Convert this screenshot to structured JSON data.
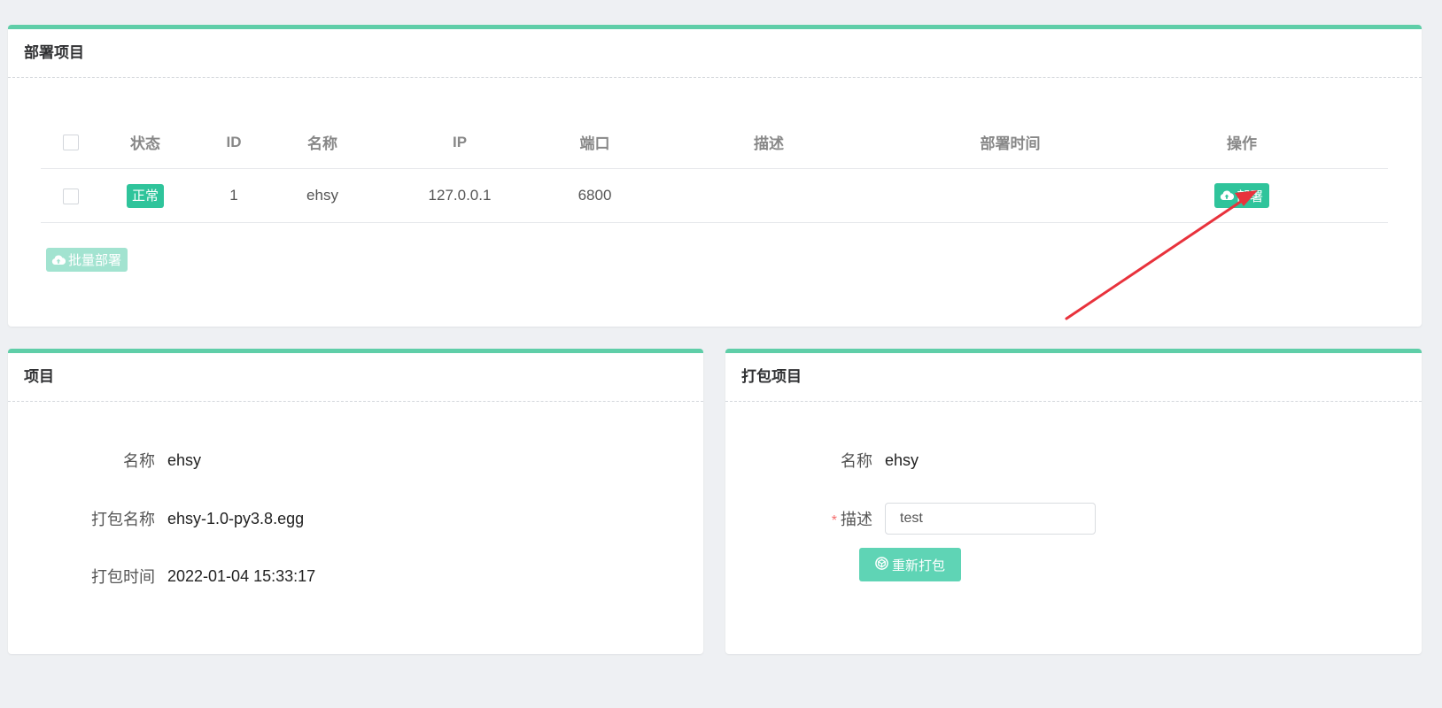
{
  "colors": {
    "accent": "#5fcea8",
    "primary": "#2fc49b",
    "disabled_button": "#a2e3d0",
    "required": "#f56c6c",
    "annotation_arrow": "#e8323c"
  },
  "deploy": {
    "title": "部署项目",
    "columns": {
      "status": "状态",
      "id": "ID",
      "name": "名称",
      "ip": "IP",
      "port": "端口",
      "desc": "描述",
      "time": "部署时间",
      "op": "操作"
    },
    "rows": [
      {
        "status": "正常",
        "id": "1",
        "name": "ehsy",
        "ip": "127.0.0.1",
        "port": "6800",
        "desc": "",
        "time": "",
        "op_label": "部署"
      }
    ],
    "batch_label": "批量部署"
  },
  "project": {
    "title": "项目",
    "name_label": "名称",
    "name_value": "ehsy",
    "pkg_label": "打包名称",
    "pkg_value": "ehsy-1.0-py3.8.egg",
    "time_label": "打包时间",
    "time_value": "2022-01-04 15:33:17"
  },
  "package": {
    "title": "打包项目",
    "name_label": "名称",
    "name_value": "ehsy",
    "required_mark": "*",
    "desc_label": "描述",
    "desc_value": "test",
    "repack_label": "重新打包"
  },
  "icons": {
    "deploy": "cloud-upload-icon",
    "batch": "cloud-upload-icon",
    "repack": "package-icon",
    "annotation": "arrow-annotation"
  }
}
